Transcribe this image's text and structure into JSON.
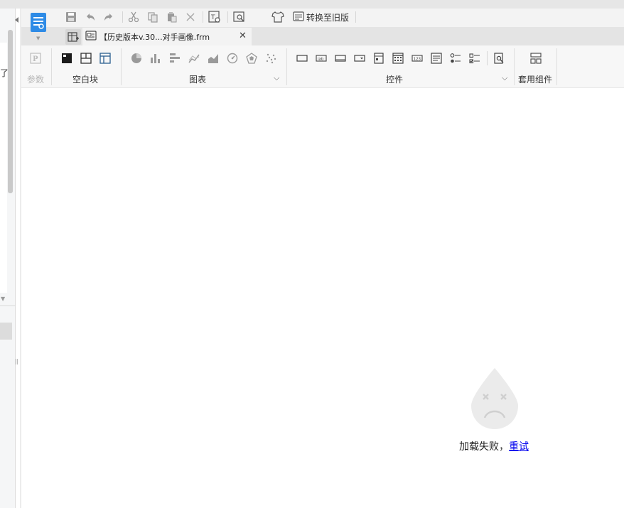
{
  "left_panel": {
    "fragment_text": "了"
  },
  "toolbar": {
    "icons": [
      "save-icon",
      "undo-icon",
      "redo-icon",
      "cut-icon",
      "copy-icon",
      "paste-icon",
      "delete-icon",
      "template-preview-icon",
      "search-preview-icon",
      "theme-shirt-icon"
    ],
    "convert_label": "转换至旧版"
  },
  "tab": {
    "label": "【历史版本v.30...对手画像.frm"
  },
  "ribbon": {
    "groups": {
      "param": "参数",
      "blank_block": "空白块",
      "chart": "图表",
      "widget": "控件",
      "component": "套用组件"
    }
  },
  "content": {
    "error_text": "加载失败，",
    "retry_label": "重试"
  },
  "colors": {
    "accent": "#2e8be6",
    "disabled": "#b5b5b5",
    "link": "#0000ee"
  }
}
